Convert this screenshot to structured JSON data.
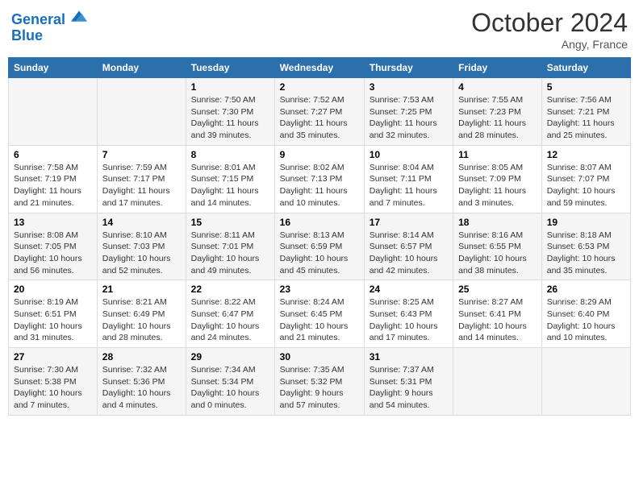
{
  "logo": {
    "line1": "General",
    "line2": "Blue"
  },
  "title": "October 2024",
  "location": "Angy, France",
  "days_header": [
    "Sunday",
    "Monday",
    "Tuesday",
    "Wednesday",
    "Thursday",
    "Friday",
    "Saturday"
  ],
  "weeks": [
    [
      {
        "day": "",
        "content": ""
      },
      {
        "day": "",
        "content": ""
      },
      {
        "day": "1",
        "content": "Sunrise: 7:50 AM\nSunset: 7:30 PM\nDaylight: 11 hours and 39 minutes."
      },
      {
        "day": "2",
        "content": "Sunrise: 7:52 AM\nSunset: 7:27 PM\nDaylight: 11 hours and 35 minutes."
      },
      {
        "day": "3",
        "content": "Sunrise: 7:53 AM\nSunset: 7:25 PM\nDaylight: 11 hours and 32 minutes."
      },
      {
        "day": "4",
        "content": "Sunrise: 7:55 AM\nSunset: 7:23 PM\nDaylight: 11 hours and 28 minutes."
      },
      {
        "day": "5",
        "content": "Sunrise: 7:56 AM\nSunset: 7:21 PM\nDaylight: 11 hours and 25 minutes."
      }
    ],
    [
      {
        "day": "6",
        "content": "Sunrise: 7:58 AM\nSunset: 7:19 PM\nDaylight: 11 hours and 21 minutes."
      },
      {
        "day": "7",
        "content": "Sunrise: 7:59 AM\nSunset: 7:17 PM\nDaylight: 11 hours and 17 minutes."
      },
      {
        "day": "8",
        "content": "Sunrise: 8:01 AM\nSunset: 7:15 PM\nDaylight: 11 hours and 14 minutes."
      },
      {
        "day": "9",
        "content": "Sunrise: 8:02 AM\nSunset: 7:13 PM\nDaylight: 11 hours and 10 minutes."
      },
      {
        "day": "10",
        "content": "Sunrise: 8:04 AM\nSunset: 7:11 PM\nDaylight: 11 hours and 7 minutes."
      },
      {
        "day": "11",
        "content": "Sunrise: 8:05 AM\nSunset: 7:09 PM\nDaylight: 11 hours and 3 minutes."
      },
      {
        "day": "12",
        "content": "Sunrise: 8:07 AM\nSunset: 7:07 PM\nDaylight: 10 hours and 59 minutes."
      }
    ],
    [
      {
        "day": "13",
        "content": "Sunrise: 8:08 AM\nSunset: 7:05 PM\nDaylight: 10 hours and 56 minutes."
      },
      {
        "day": "14",
        "content": "Sunrise: 8:10 AM\nSunset: 7:03 PM\nDaylight: 10 hours and 52 minutes."
      },
      {
        "day": "15",
        "content": "Sunrise: 8:11 AM\nSunset: 7:01 PM\nDaylight: 10 hours and 49 minutes."
      },
      {
        "day": "16",
        "content": "Sunrise: 8:13 AM\nSunset: 6:59 PM\nDaylight: 10 hours and 45 minutes."
      },
      {
        "day": "17",
        "content": "Sunrise: 8:14 AM\nSunset: 6:57 PM\nDaylight: 10 hours and 42 minutes."
      },
      {
        "day": "18",
        "content": "Sunrise: 8:16 AM\nSunset: 6:55 PM\nDaylight: 10 hours and 38 minutes."
      },
      {
        "day": "19",
        "content": "Sunrise: 8:18 AM\nSunset: 6:53 PM\nDaylight: 10 hours and 35 minutes."
      }
    ],
    [
      {
        "day": "20",
        "content": "Sunrise: 8:19 AM\nSunset: 6:51 PM\nDaylight: 10 hours and 31 minutes."
      },
      {
        "day": "21",
        "content": "Sunrise: 8:21 AM\nSunset: 6:49 PM\nDaylight: 10 hours and 28 minutes."
      },
      {
        "day": "22",
        "content": "Sunrise: 8:22 AM\nSunset: 6:47 PM\nDaylight: 10 hours and 24 minutes."
      },
      {
        "day": "23",
        "content": "Sunrise: 8:24 AM\nSunset: 6:45 PM\nDaylight: 10 hours and 21 minutes."
      },
      {
        "day": "24",
        "content": "Sunrise: 8:25 AM\nSunset: 6:43 PM\nDaylight: 10 hours and 17 minutes."
      },
      {
        "day": "25",
        "content": "Sunrise: 8:27 AM\nSunset: 6:41 PM\nDaylight: 10 hours and 14 minutes."
      },
      {
        "day": "26",
        "content": "Sunrise: 8:29 AM\nSunset: 6:40 PM\nDaylight: 10 hours and 10 minutes."
      }
    ],
    [
      {
        "day": "27",
        "content": "Sunrise: 7:30 AM\nSunset: 5:38 PM\nDaylight: 10 hours and 7 minutes."
      },
      {
        "day": "28",
        "content": "Sunrise: 7:32 AM\nSunset: 5:36 PM\nDaylight: 10 hours and 4 minutes."
      },
      {
        "day": "29",
        "content": "Sunrise: 7:34 AM\nSunset: 5:34 PM\nDaylight: 10 hours and 0 minutes."
      },
      {
        "day": "30",
        "content": "Sunrise: 7:35 AM\nSunset: 5:32 PM\nDaylight: 9 hours and 57 minutes."
      },
      {
        "day": "31",
        "content": "Sunrise: 7:37 AM\nSunset: 5:31 PM\nDaylight: 9 hours and 54 minutes."
      },
      {
        "day": "",
        "content": ""
      },
      {
        "day": "",
        "content": ""
      }
    ]
  ]
}
